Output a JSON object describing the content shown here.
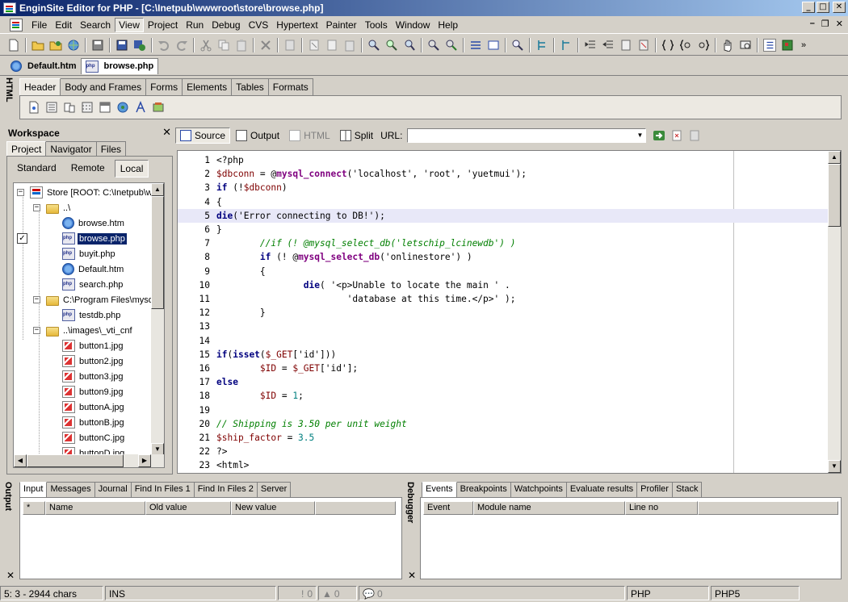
{
  "window": {
    "title": "EnginSite Editor for PHP - [C:\\Inetpub\\wwwroot\\store\\browse.php]",
    "minimize": "_",
    "maximize": "□",
    "close": "✕"
  },
  "menu": {
    "items": [
      "File",
      "Edit",
      "Search",
      "View",
      "Project",
      "Run",
      "Debug",
      "CVS",
      "Hypertext",
      "Painter",
      "Tools",
      "Window",
      "Help"
    ],
    "active": "View",
    "mdi_min": "–",
    "mdi_restore": "❐",
    "mdi_close": "✕"
  },
  "doc_tabs": [
    {
      "label": "Default.htm",
      "active": false
    },
    {
      "label": "browse.php",
      "active": true
    }
  ],
  "html_palette": {
    "side_label": "HTML",
    "tabs": [
      "Header",
      "Body and Frames",
      "Forms",
      "Elements",
      "Tables",
      "Formats"
    ],
    "active": "Header"
  },
  "workspace": {
    "title": "Workspace",
    "close": "✕",
    "tabs": [
      "Project",
      "Navigator",
      "Files"
    ],
    "active_tab": "Project",
    "location_buttons": [
      "Standard",
      "Remote",
      "Local"
    ],
    "active_location": "Local",
    "tree": [
      {
        "label": "Store [ROOT: C:\\Inetpub\\wwwroot\\store]",
        "icon": "site-icon",
        "level": 0,
        "toggle": "−"
      },
      {
        "label": "..\\",
        "icon": "folder-icon",
        "level": 1,
        "toggle": "−"
      },
      {
        "label": "browse.htm",
        "icon": "htm-file-icon",
        "level": 2
      },
      {
        "label": "browse.php",
        "icon": "php-file-icon",
        "level": 2,
        "selected": true,
        "checked": "✓"
      },
      {
        "label": "buyit.php",
        "icon": "php-file-icon",
        "level": 2
      },
      {
        "label": "Default.htm",
        "icon": "htm-file-icon",
        "level": 2
      },
      {
        "label": "search.php",
        "icon": "php-file-icon",
        "level": 2
      },
      {
        "label": "C:\\Program Files\\mysql\\",
        "icon": "folder-icon",
        "level": 1,
        "toggle": "−"
      },
      {
        "label": "testdb.php",
        "icon": "php-file-icon",
        "level": 2
      },
      {
        "label": "..\\images\\_vti_cnf",
        "icon": "folder-icon",
        "level": 1,
        "toggle": "−"
      },
      {
        "label": "button1.jpg",
        "icon": "jpg-file-icon",
        "level": 2
      },
      {
        "label": "button2.jpg",
        "icon": "jpg-file-icon",
        "level": 2
      },
      {
        "label": "button3.jpg",
        "icon": "jpg-file-icon",
        "level": 2
      },
      {
        "label": "button9.jpg",
        "icon": "jpg-file-icon",
        "level": 2
      },
      {
        "label": "buttonA.jpg",
        "icon": "jpg-file-icon",
        "level": 2
      },
      {
        "label": "buttonB.jpg",
        "icon": "jpg-file-icon",
        "level": 2
      },
      {
        "label": "buttonC.jpg",
        "icon": "jpg-file-icon",
        "level": 2
      },
      {
        "label": "buttonD.jpg",
        "icon": "jpg-file-icon",
        "level": 2
      }
    ]
  },
  "editor_toolbar": {
    "buttons": [
      {
        "label": "Source",
        "active": true,
        "disabled": false
      },
      {
        "label": "Output",
        "active": false,
        "disabled": false
      },
      {
        "label": "HTML",
        "active": false,
        "disabled": true
      },
      {
        "label": "Split",
        "active": false,
        "disabled": false
      }
    ],
    "url_label": "URL:",
    "url_value": ""
  },
  "editor": {
    "current_line": 5,
    "lines": [
      [
        [
          "tag",
          "<?php"
        ]
      ],
      [
        [
          "var",
          "$dbconn"
        ],
        [
          "str",
          " = @"
        ],
        [
          "fn",
          "mysql_connect"
        ],
        [
          "str",
          "('localhost', 'root', 'yuetmui');"
        ]
      ],
      [
        [
          "kw",
          "if"
        ],
        [
          "str",
          " (!"
        ],
        [
          "var",
          "$dbconn"
        ],
        [
          "str",
          ")"
        ]
      ],
      [
        [
          "str",
          "{"
        ]
      ],
      [
        [
          "kw",
          "die"
        ],
        [
          "str",
          "('Error connecting to DB!');"
        ]
      ],
      [
        [
          "str",
          "}"
        ]
      ],
      [
        [
          "cmt",
          "        //if (! @mysql_select_db('letschip_lcinewdb') )"
        ]
      ],
      [
        [
          "str",
          "        "
        ],
        [
          "kw",
          "if"
        ],
        [
          "str",
          " (! @"
        ],
        [
          "fn",
          "mysql_select_db"
        ],
        [
          "str",
          "('onlinestore') )"
        ]
      ],
      [
        [
          "str",
          "        {"
        ]
      ],
      [
        [
          "str",
          "                "
        ],
        [
          "kw",
          "die"
        ],
        [
          "str",
          "( '<p>Unable to locate the main ' ."
        ]
      ],
      [
        [
          "str",
          "                        'database at this time.</p>' );"
        ]
      ],
      [
        [
          "str",
          "        }"
        ]
      ],
      [
        [
          "str",
          ""
        ]
      ],
      [
        [
          "str",
          ""
        ]
      ],
      [
        [
          "kw",
          "if"
        ],
        [
          "str",
          "("
        ],
        [
          "kw",
          "isset"
        ],
        [
          "str",
          "("
        ],
        [
          "var",
          "$_GET"
        ],
        [
          "str",
          "['id']))"
        ]
      ],
      [
        [
          "str",
          "        "
        ],
        [
          "var",
          "$ID"
        ],
        [
          "str",
          " = "
        ],
        [
          "var",
          "$_GET"
        ],
        [
          "str",
          "['id'];"
        ]
      ],
      [
        [
          "kw",
          "else"
        ]
      ],
      [
        [
          "str",
          "        "
        ],
        [
          "var",
          "$ID"
        ],
        [
          "str",
          " = "
        ],
        [
          "num",
          "1"
        ],
        [
          "str",
          ";"
        ]
      ],
      [
        [
          "str",
          ""
        ]
      ],
      [
        [
          "cmt",
          "// Shipping is 3.50 per unit weight"
        ]
      ],
      [
        [
          "var",
          "$ship_factor"
        ],
        [
          "str",
          " = "
        ],
        [
          "num",
          "3.5"
        ]
      ],
      [
        [
          "tag",
          "?>"
        ]
      ],
      [
        [
          "tag",
          "<html>"
        ]
      ]
    ]
  },
  "output_panel": {
    "side_label": "Output",
    "tabs": [
      "Input",
      "Messages",
      "Journal",
      "Find In Files 1",
      "Find In Files 2",
      "Server"
    ],
    "active": "Input",
    "columns": [
      "*",
      "Name",
      "Old value",
      "New value"
    ],
    "close": "✕"
  },
  "debugger_panel": {
    "side_label": "Debugger",
    "tabs": [
      "Events",
      "Breakpoints",
      "Watchpoints",
      "Evaluate results",
      "Profiler",
      "Stack"
    ],
    "active": "Events",
    "columns": [
      "Event",
      "Module name",
      "Line no"
    ],
    "close": "✕"
  },
  "status": {
    "position": "5: 3 - 2944 chars",
    "mode": "INS",
    "errors": "0",
    "warnings": "0",
    "messages": "0",
    "language": "PHP",
    "version": "PHP5"
  },
  "colors": {
    "title_start": "#0a246a",
    "title_end": "#a6caf0",
    "chrome": "#d4d0c8",
    "selection": "#0a246a"
  }
}
